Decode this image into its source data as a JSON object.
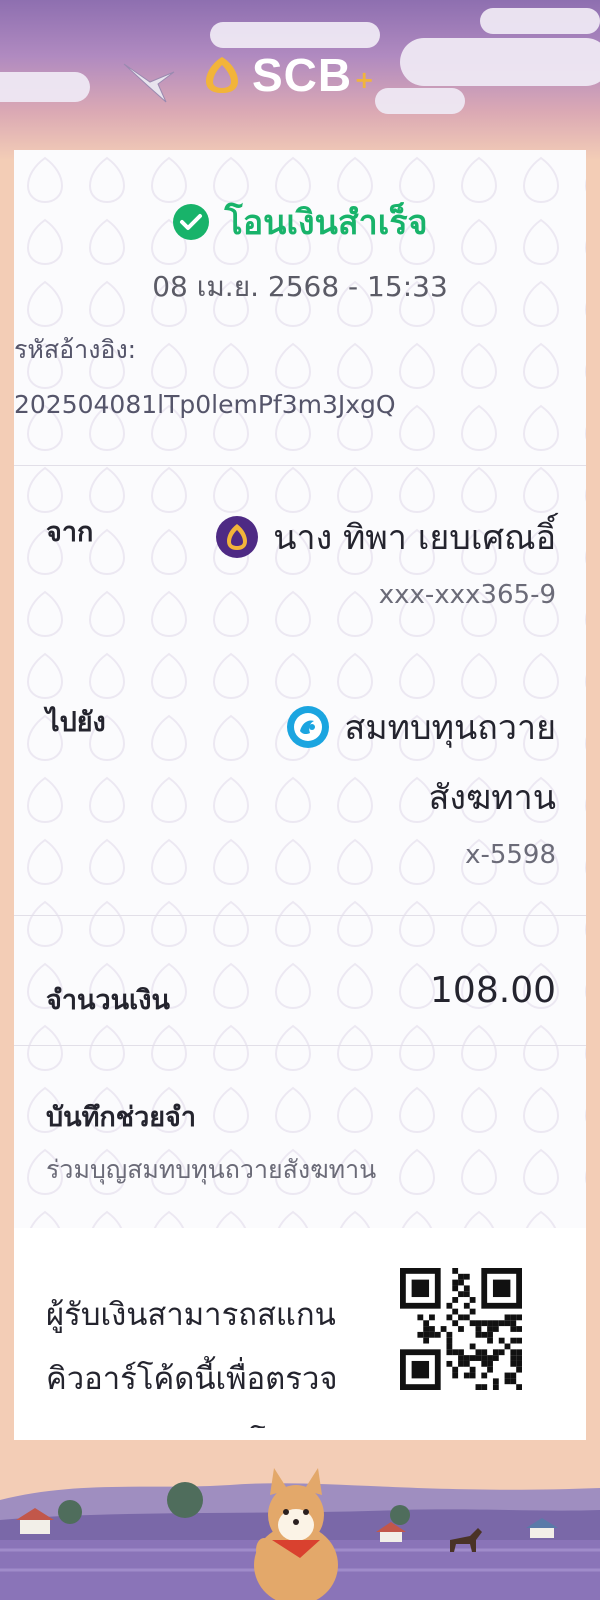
{
  "brand": {
    "name": "SCB",
    "plus": "+"
  },
  "status": {
    "text": "โอนเงินสำเร็จ",
    "icon": "check-circle-icon",
    "color": "#18b36a"
  },
  "datetime": "08 เม.ย. 2568 - 15:33",
  "reference": {
    "label": "รหัสอ้างอิง:",
    "value": "202504081lTp0lemPf3m3JxgQ"
  },
  "from": {
    "label": "จาก",
    "name": "นาง ทิพา เยบเศณอิ์",
    "account": "xxx-xxx365-9",
    "icon": "scb-bank-icon"
  },
  "to": {
    "label": "ไปยัง",
    "name_line1": "สมทบทุนถวาย",
    "name_line2": "สังฆทาน",
    "account": "x-5598",
    "icon": "ktb-bank-icon"
  },
  "amount": {
    "label": "จำนวนเงิน",
    "value": "108.00"
  },
  "memo": {
    "label": "บันทึกช่วยจำ",
    "value": "ร่วมบุญสมทบทุนถวายสังฆทาน"
  },
  "qr": {
    "text": "ผู้รับเงินสามารถสแกนคิวอาร์โค้ดนี้เพื่อตรวจสอบสถานะการโอนเงิน",
    "icon": "qr-code-icon"
  },
  "colors": {
    "accent": "#4e2a84",
    "success": "#18b36a",
    "background": "#f3cdb6"
  }
}
